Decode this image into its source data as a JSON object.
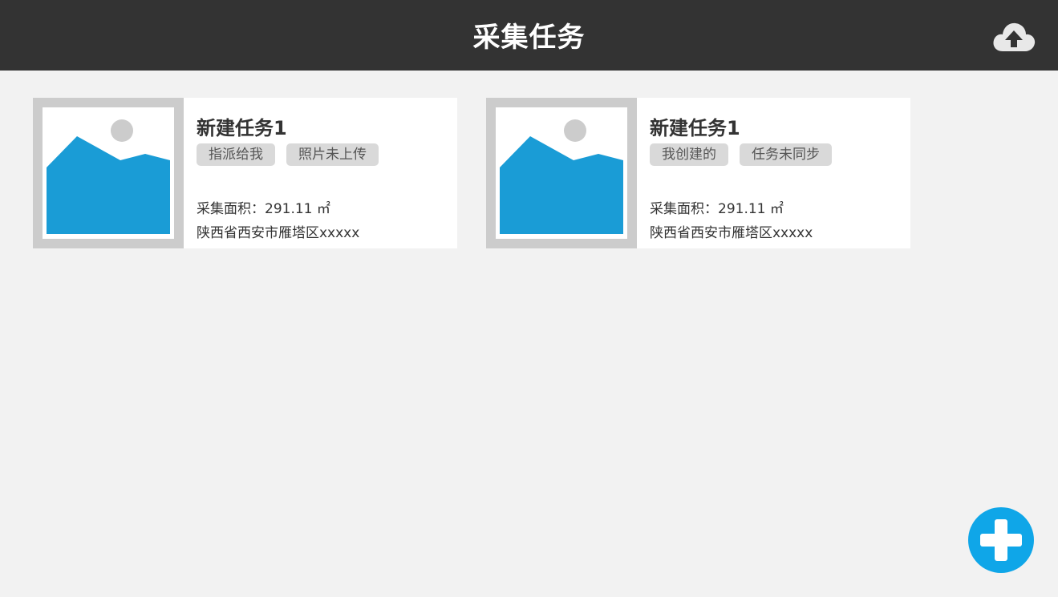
{
  "header": {
    "title": "采集任务",
    "upload_icon": "cloud-upload-icon"
  },
  "tasks": [
    {
      "title": "新建任务1",
      "tags": [
        "指派给我",
        "照片未上传"
      ],
      "area": "采集面积：291.11 ㎡",
      "address": "陕西省西安市雁塔区xxxxx",
      "thumbnail_icon": "image-placeholder-icon"
    },
    {
      "title": "新建任务1",
      "tags": [
        "我创建的",
        "任务未同步"
      ],
      "area": "采集面积：291.11 ㎡",
      "address": "陕西省西安市雁塔区xxxxx",
      "thumbnail_icon": "image-placeholder-icon"
    }
  ],
  "fab": {
    "icon": "plus-icon"
  },
  "colors": {
    "header_bg": "#333333",
    "page_bg": "#f2f2f2",
    "accent": "#0fa6e8",
    "thumb_blue": "#1a9cd6",
    "tag_bg": "#d9d9d9"
  }
}
